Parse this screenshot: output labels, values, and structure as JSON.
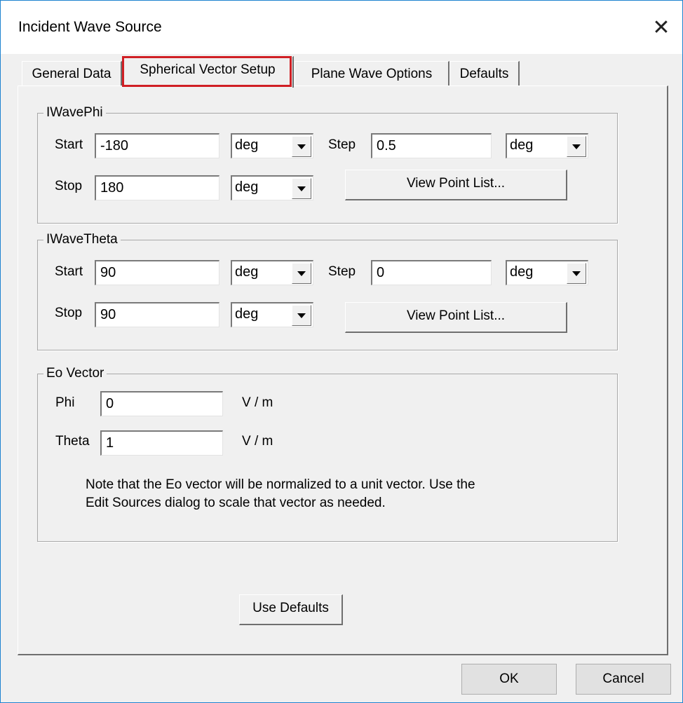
{
  "window": {
    "title": "Incident Wave Source"
  },
  "tabs": [
    {
      "label": "General Data"
    },
    {
      "label": "Spherical Vector Setup"
    },
    {
      "label": "Plane Wave Options"
    },
    {
      "label": "Defaults"
    }
  ],
  "phi_group": {
    "legend": "IWavePhi",
    "start_label": "Start",
    "start_value": "-180",
    "start_unit": "deg",
    "step_label": "Step",
    "step_value": "0.5",
    "step_unit": "deg",
    "stop_label": "Stop",
    "stop_value": "180",
    "stop_unit": "deg",
    "view_button": "View Point List..."
  },
  "theta_group": {
    "legend": "IWaveTheta",
    "start_label": "Start",
    "start_value": "90",
    "start_unit": "deg",
    "step_label": "Step",
    "step_value": "0",
    "step_unit": "deg",
    "stop_label": "Stop",
    "stop_value": "90",
    "stop_unit": "deg",
    "view_button": "View Point List..."
  },
  "eo_group": {
    "legend": "Eo Vector",
    "phi_label": "Phi",
    "phi_value": "0",
    "phi_unit": "V / m",
    "theta_label": "Theta",
    "theta_value": "1",
    "theta_unit": "V / m",
    "note_line1": "Note that the Eo vector will be normalized to a unit vector.  Use the",
    "note_line2": "Edit Sources dialog to scale that vector as needed."
  },
  "buttons": {
    "use_defaults": "Use Defaults",
    "ok": "OK",
    "cancel": "Cancel"
  }
}
